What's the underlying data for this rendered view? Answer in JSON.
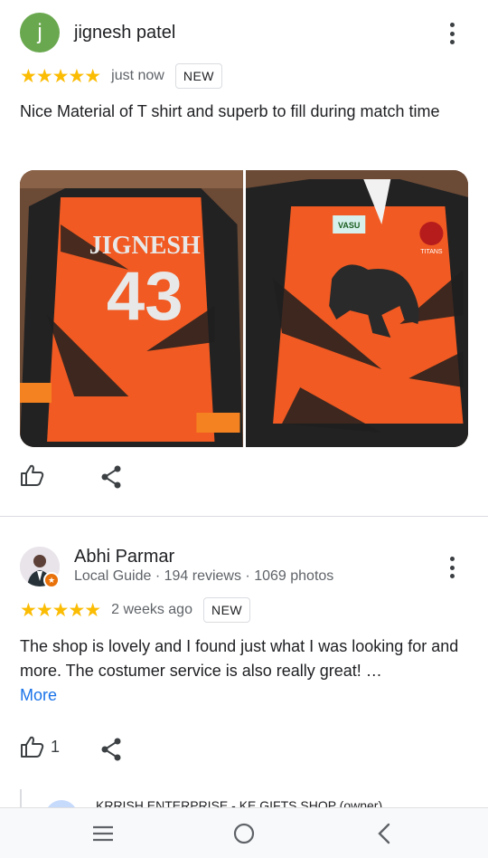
{
  "reviews": [
    {
      "avatar_letter": "j",
      "name": "jignesh patel",
      "stars": "★★★★★",
      "time": "just now",
      "badge": "NEW",
      "text": "Nice Material of T shirt and superb to fill during match time",
      "photos": [
        {
          "name_on_shirt": "JIGNESH",
          "number": "43"
        },
        {
          "logo_left": "VASU",
          "logo_right": "TITANS"
        }
      ]
    },
    {
      "name": "Abhi Parmar",
      "meta": "Local Guide · 194 reviews · 1069 photos",
      "stars": "★★★★★",
      "time": "2 weeks ago",
      "badge": "NEW",
      "text": "The shop is lovely and I found just what I was looking for and more. The costumer service is also really great! …",
      "more_link": "More",
      "like_count": "1",
      "owner_reply_header": "KRRISH ENTERPRISE - KE GIFTS SHOP (owner)"
    }
  ],
  "colors": {
    "star": "#fbbc04",
    "link": "#1a73e8",
    "avatar_green": "#6aa84f",
    "jersey_orange": "#f15a22"
  }
}
